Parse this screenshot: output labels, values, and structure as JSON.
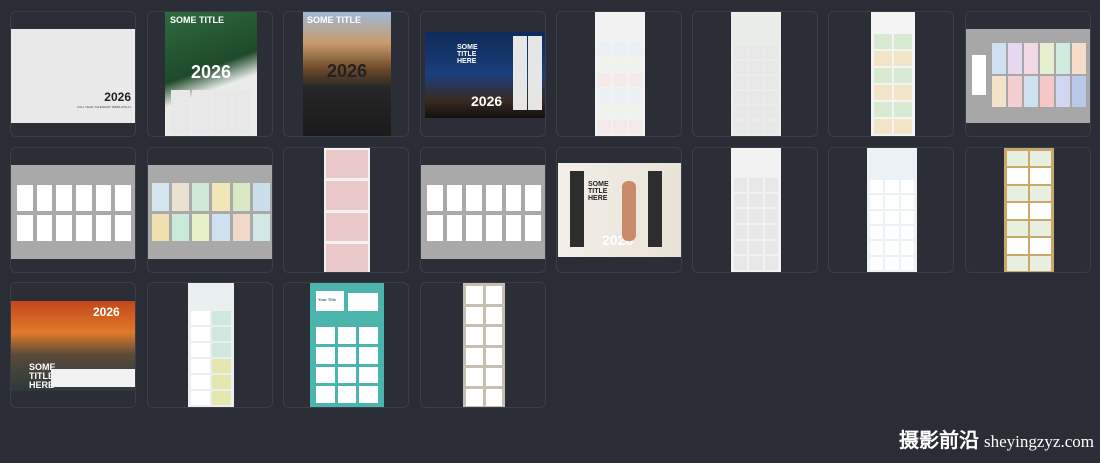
{
  "templates": {
    "t1": {
      "year": "2026",
      "subtitle": "FULL YEAR CALENDAR TEMPLATE 01"
    },
    "t2": {
      "title": "SOME TITLE",
      "year": "2026"
    },
    "t3": {
      "title": "SOME TITLE",
      "year": "2026"
    },
    "t4": {
      "title": "SOME TITLE HERE",
      "year": "2026"
    },
    "t20": {
      "title": "SOME TITLE HERE",
      "year": "2026"
    },
    "t24": {
      "title": "SOME TITLE HERE",
      "year": "2026"
    },
    "t28": {
      "title": "Your Title"
    }
  },
  "colors": {
    "background": "#2a2d35",
    "card_border": "#3a3e48"
  },
  "watermark": {
    "cjk": "摄影前沿",
    "latin": "sheyingzyz.com"
  }
}
